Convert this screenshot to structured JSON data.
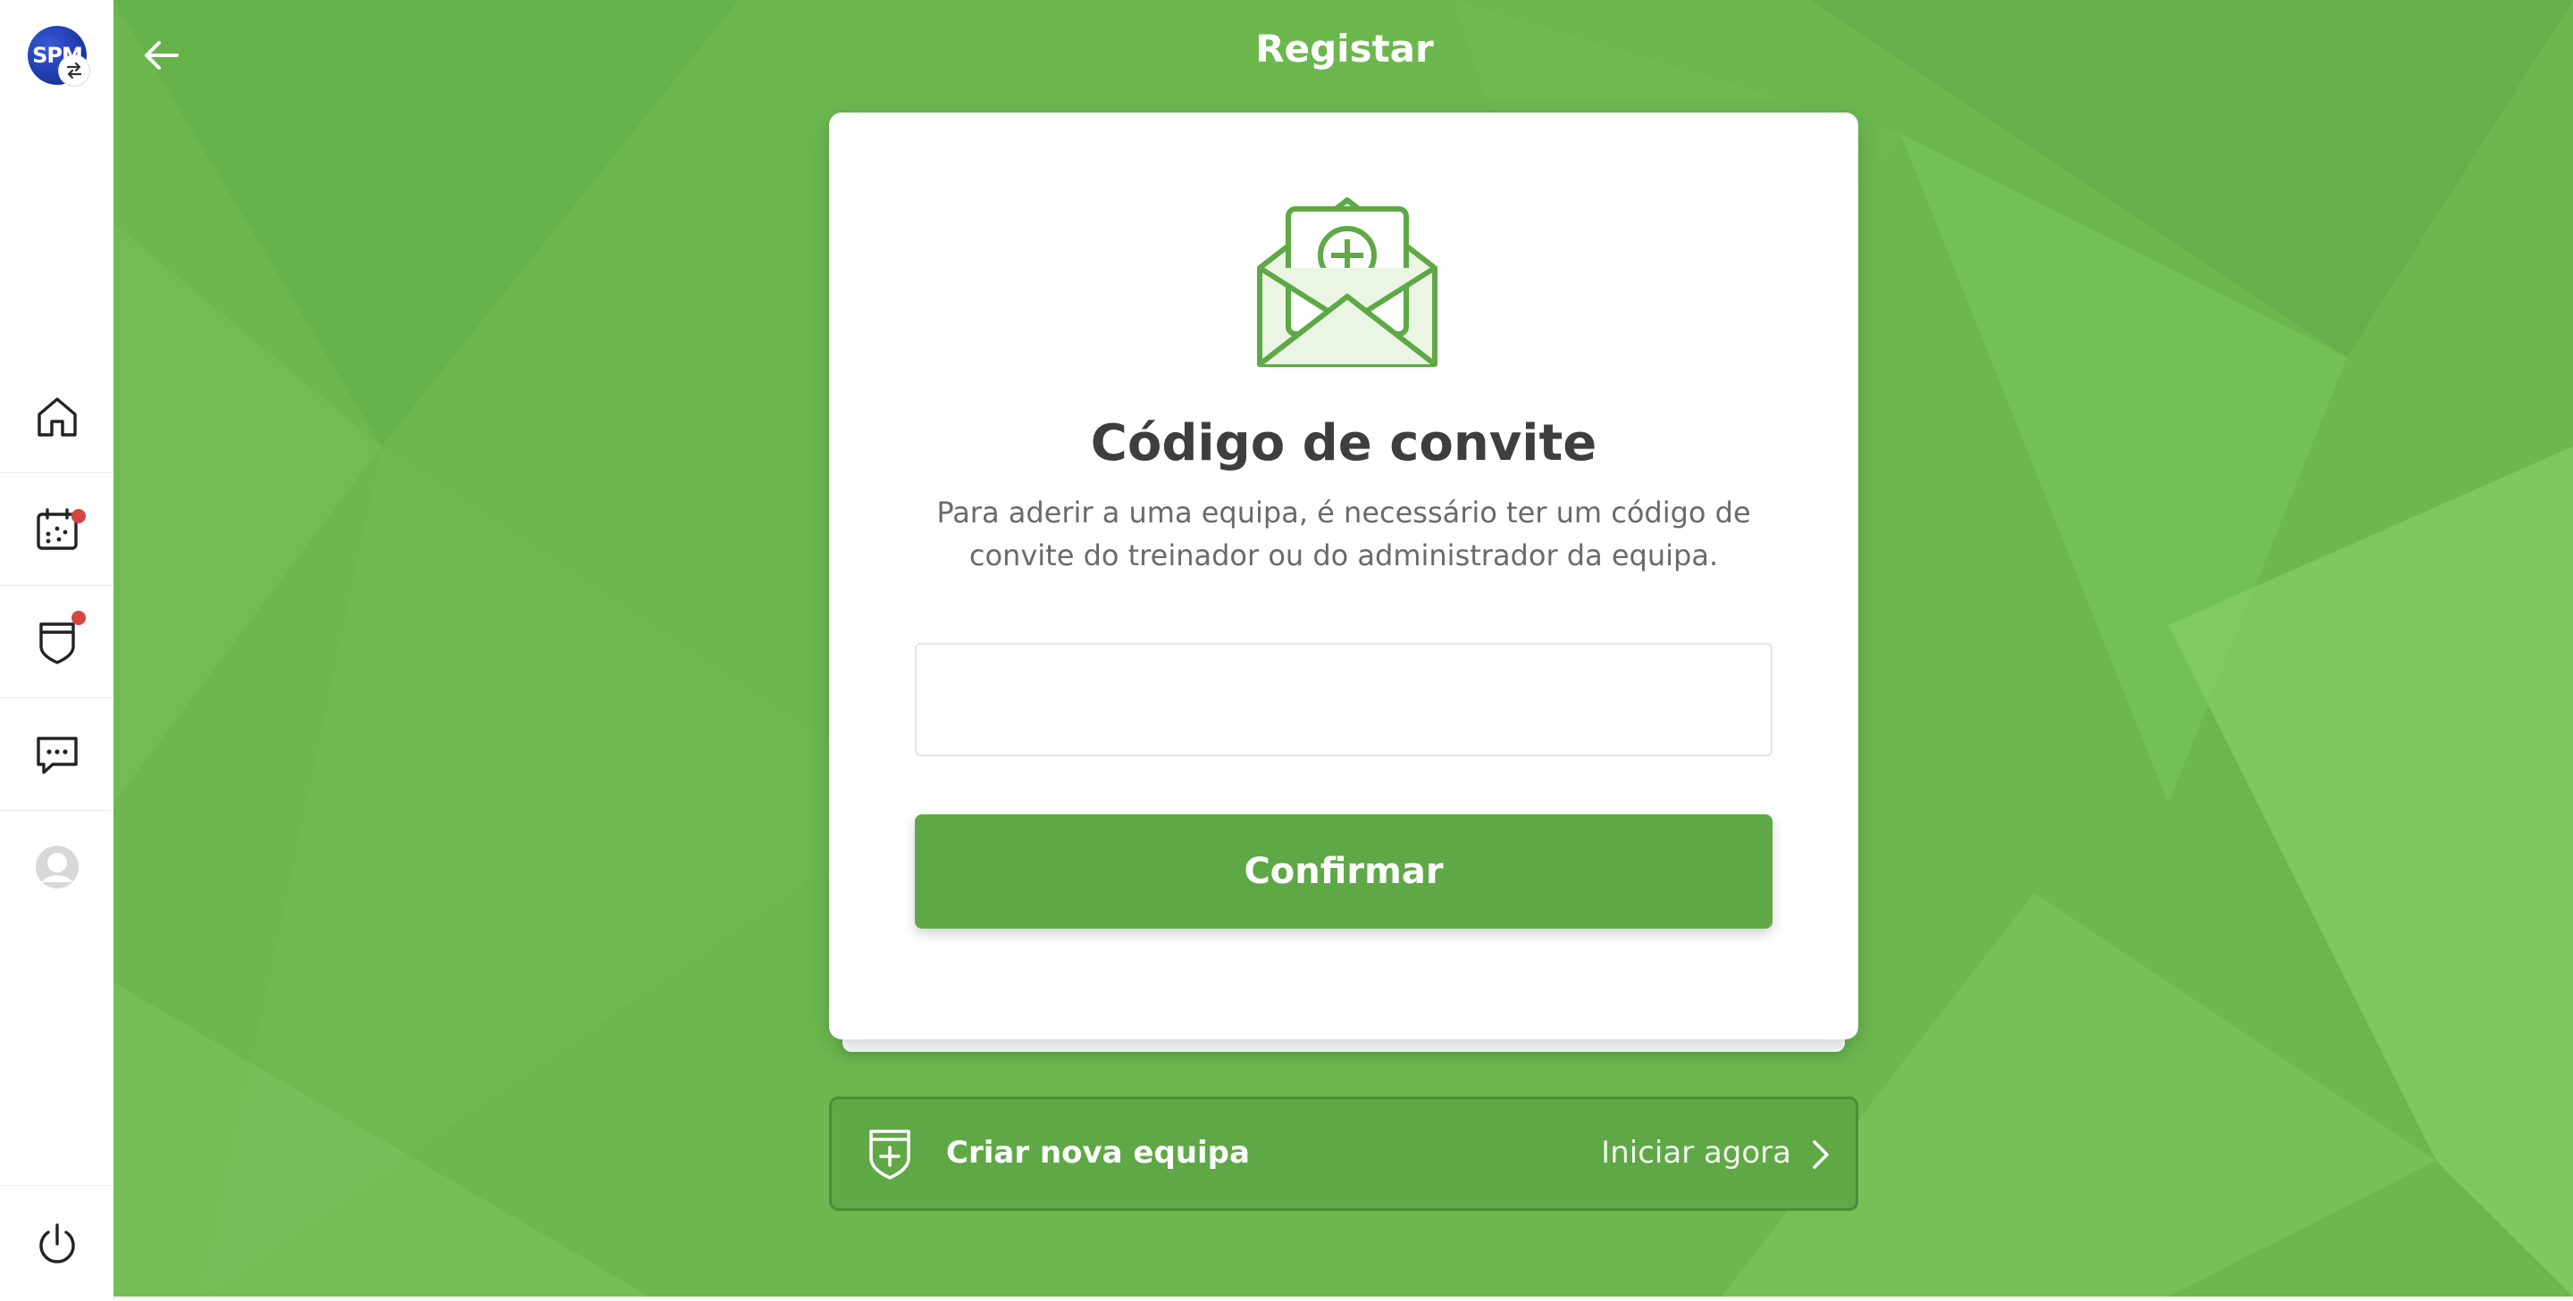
{
  "sidebar": {
    "logo_text": "SPM",
    "items": [
      {
        "name": "home",
        "icon": "home-icon"
      },
      {
        "name": "calendar",
        "icon": "calendar-icon",
        "has_notification": true
      },
      {
        "name": "teams",
        "icon": "shield-icon",
        "has_notification": true
      },
      {
        "name": "messages",
        "icon": "chat-icon"
      },
      {
        "name": "profile",
        "icon": "avatar-icon"
      }
    ],
    "logout_icon": "power-icon"
  },
  "header": {
    "back_icon": "arrow-left-icon",
    "title": "Registar"
  },
  "card": {
    "icon": "envelope-plus-icon",
    "title": "Código de convite",
    "description": "Para aderir a uma equipa, é necessário ter um código de convite do treinador ou do administrador da equipa.",
    "input_value": "",
    "confirm_label": "Confirmar"
  },
  "create_team": {
    "icon": "shield-plus-icon",
    "label": "Criar nova equipa",
    "action": "Iniciar agora",
    "chevron_icon": "chevron-right-icon"
  },
  "colors": {
    "accent": "#5fa846",
    "background": "#6cb84f",
    "notification": "#d64541"
  }
}
